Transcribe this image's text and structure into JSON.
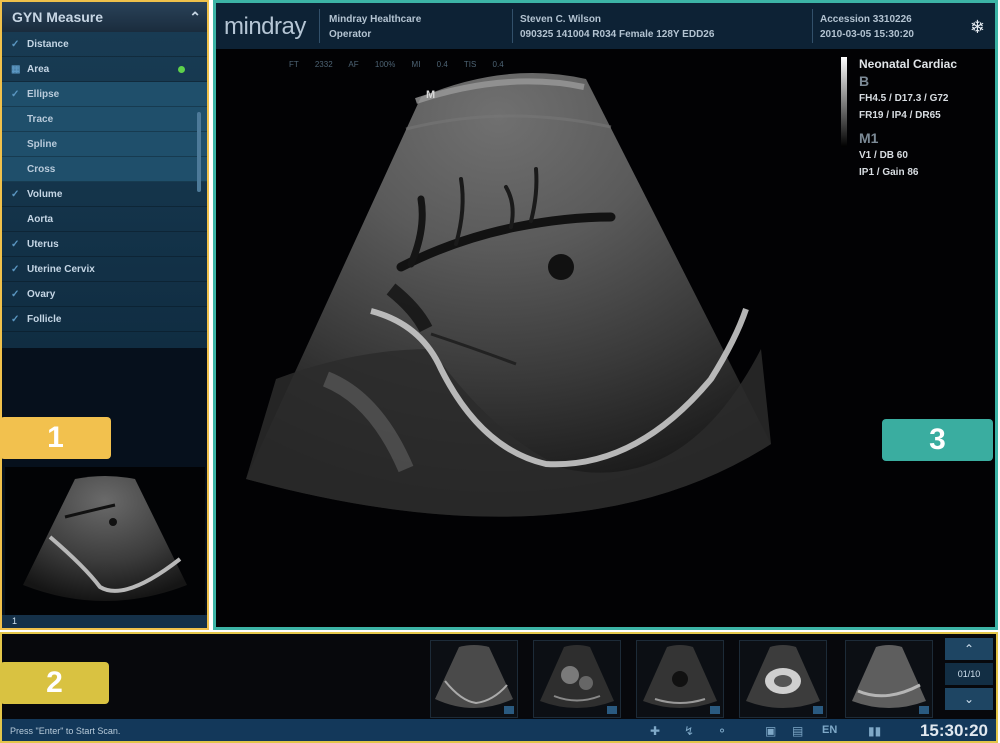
{
  "measure_panel": {
    "title": "GYN Measure",
    "items": [
      {
        "label": "Distance",
        "icon": "check",
        "active": false
      },
      {
        "label": "Area",
        "icon": "area",
        "active": true
      },
      {
        "label": "Ellipse",
        "icon": "check",
        "active": false
      },
      {
        "label": "Trace",
        "icon": "none",
        "active": false
      },
      {
        "label": "Spline",
        "icon": "none",
        "active": false
      },
      {
        "label": "Cross",
        "icon": "none",
        "active": false
      },
      {
        "label": "Volume",
        "icon": "check",
        "active": false
      },
      {
        "label": "Aorta",
        "icon": "none",
        "active": false
      },
      {
        "label": "Uterus",
        "icon": "check",
        "active": false
      },
      {
        "label": "Uterine Cervix",
        "icon": "check",
        "active": false
      },
      {
        "label": "Ovary",
        "icon": "check",
        "active": false
      },
      {
        "label": "Follicle",
        "icon": "check",
        "active": false
      }
    ],
    "thumbnail_index": "1"
  },
  "callouts": {
    "one": "1",
    "two": "2",
    "three": "3"
  },
  "header": {
    "logo": "mindray",
    "hospital": "Mindray Healthcare",
    "operator": "Operator",
    "patient_name": "Steven C. Wilson",
    "patient_details": "090325 141004 R034  Female  128Y  EDD26",
    "accession_label": "Accession  3310226",
    "exam_datetime": "2010-03-05 15:30:20"
  },
  "scan_params": "FT 2332  AF 100%  MI 0.4  TIS 0.4",
  "image_marker": "M",
  "right_info": {
    "preset": "Neonatal Cardiac",
    "b_mode": "B",
    "b_line1": "FH4.5 / D17.3 / G72",
    "b_line2": "FR19 / IP4 / DR65",
    "m_mode": "M1",
    "m_line1": "V1  / DB  60",
    "m_line2": "IP1 / Gain  86"
  },
  "clips": {
    "page_label": "01/10"
  },
  "status_bar": {
    "hint": "Press \"Enter\" to Start Scan.",
    "clock": "15:30:20",
    "lang": "EN"
  },
  "colors": {
    "callout_1": "#f2c14e",
    "callout_2": "#d9c241",
    "callout_3": "#3aada0"
  }
}
